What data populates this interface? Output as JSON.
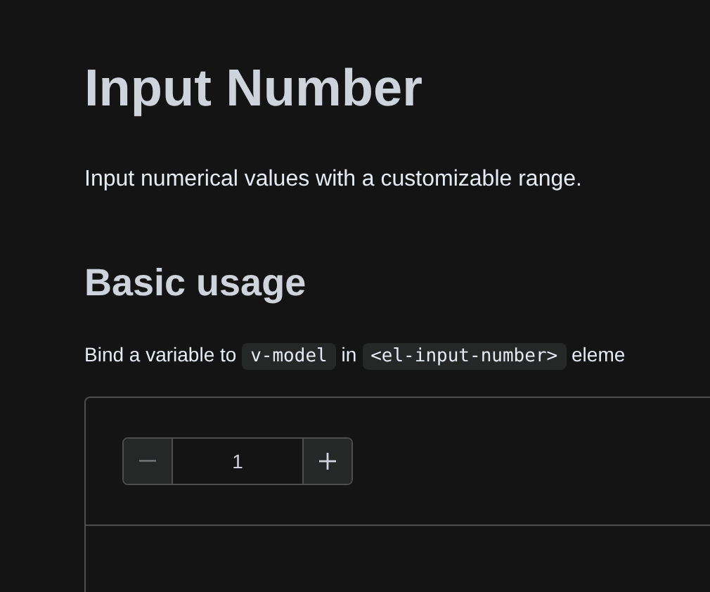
{
  "title": "Input Number",
  "description": "Input numerical values with a customizable range.",
  "section": {
    "heading": "Basic usage",
    "intro": [
      {
        "kind": "text",
        "text": "Bind a variable to"
      },
      {
        "kind": "code",
        "text": "v-model"
      },
      {
        "kind": "text",
        "text": "in"
      },
      {
        "kind": "code",
        "text": "<el-input-number>"
      },
      {
        "kind": "text",
        "text": "eleme"
      }
    ],
    "demo": {
      "input_number": {
        "value": "1",
        "decrease_disabled": true,
        "increase_disabled": false
      }
    }
  }
}
